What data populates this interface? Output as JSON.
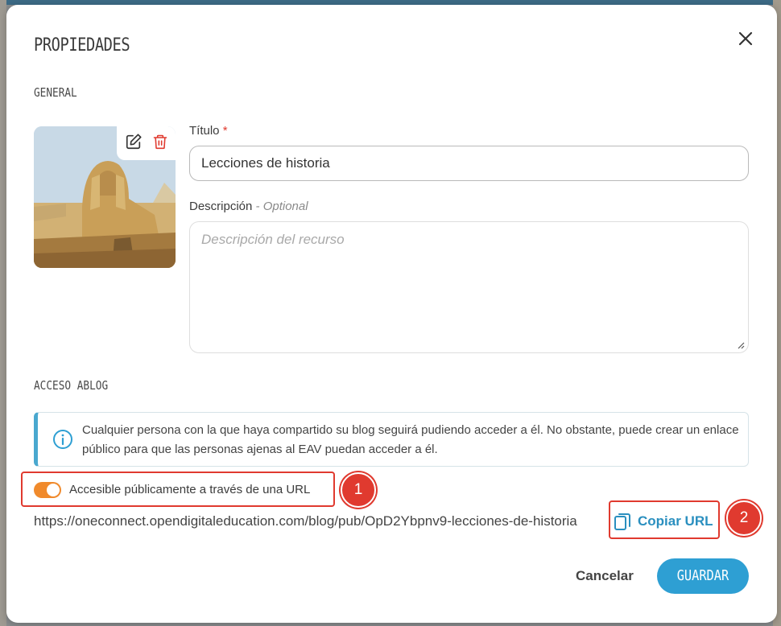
{
  "modal": {
    "title": "PROPIEDADES",
    "close_icon": "close-icon"
  },
  "general": {
    "section_label": "GENERAL",
    "thumbnail": {
      "edit_icon": "edit-icon",
      "delete_icon": "trash-icon"
    },
    "title_field": {
      "label": "Título",
      "required_mark": "*",
      "value": "Lecciones de historia"
    },
    "description_field": {
      "label": "Descripción",
      "optional_label": "- Optional",
      "placeholder": "Descripción del recurso"
    }
  },
  "access": {
    "section_label": "ACCESO ABLOG",
    "info": {
      "icon": "info-icon",
      "text": "Cualquier persona con la que haya compartido su blog seguirá pudiendo acceder a él. No obstante, puede crear un enlace público para que las personas ajenas al EAV puedan acceder a él."
    },
    "toggle": {
      "label": "Accesible públicamente a través de una URL",
      "on": true
    },
    "url": "https://oneconnect.opendigitaleducation.com/blog/pub/OpD2Ybpnv9-lecciones-de-historia",
    "copy_label": "Copiar URL",
    "copy_icon": "copy-icon"
  },
  "annotations": {
    "badge_1": "1",
    "badge_2": "2"
  },
  "footer": {
    "cancel_label": "Cancelar",
    "save_label": "GUARDAR"
  },
  "colors": {
    "accent": "#2e9fd3",
    "toggle": "#f08a2c",
    "highlight": "#e03a2f",
    "required": "#e03a2f"
  }
}
